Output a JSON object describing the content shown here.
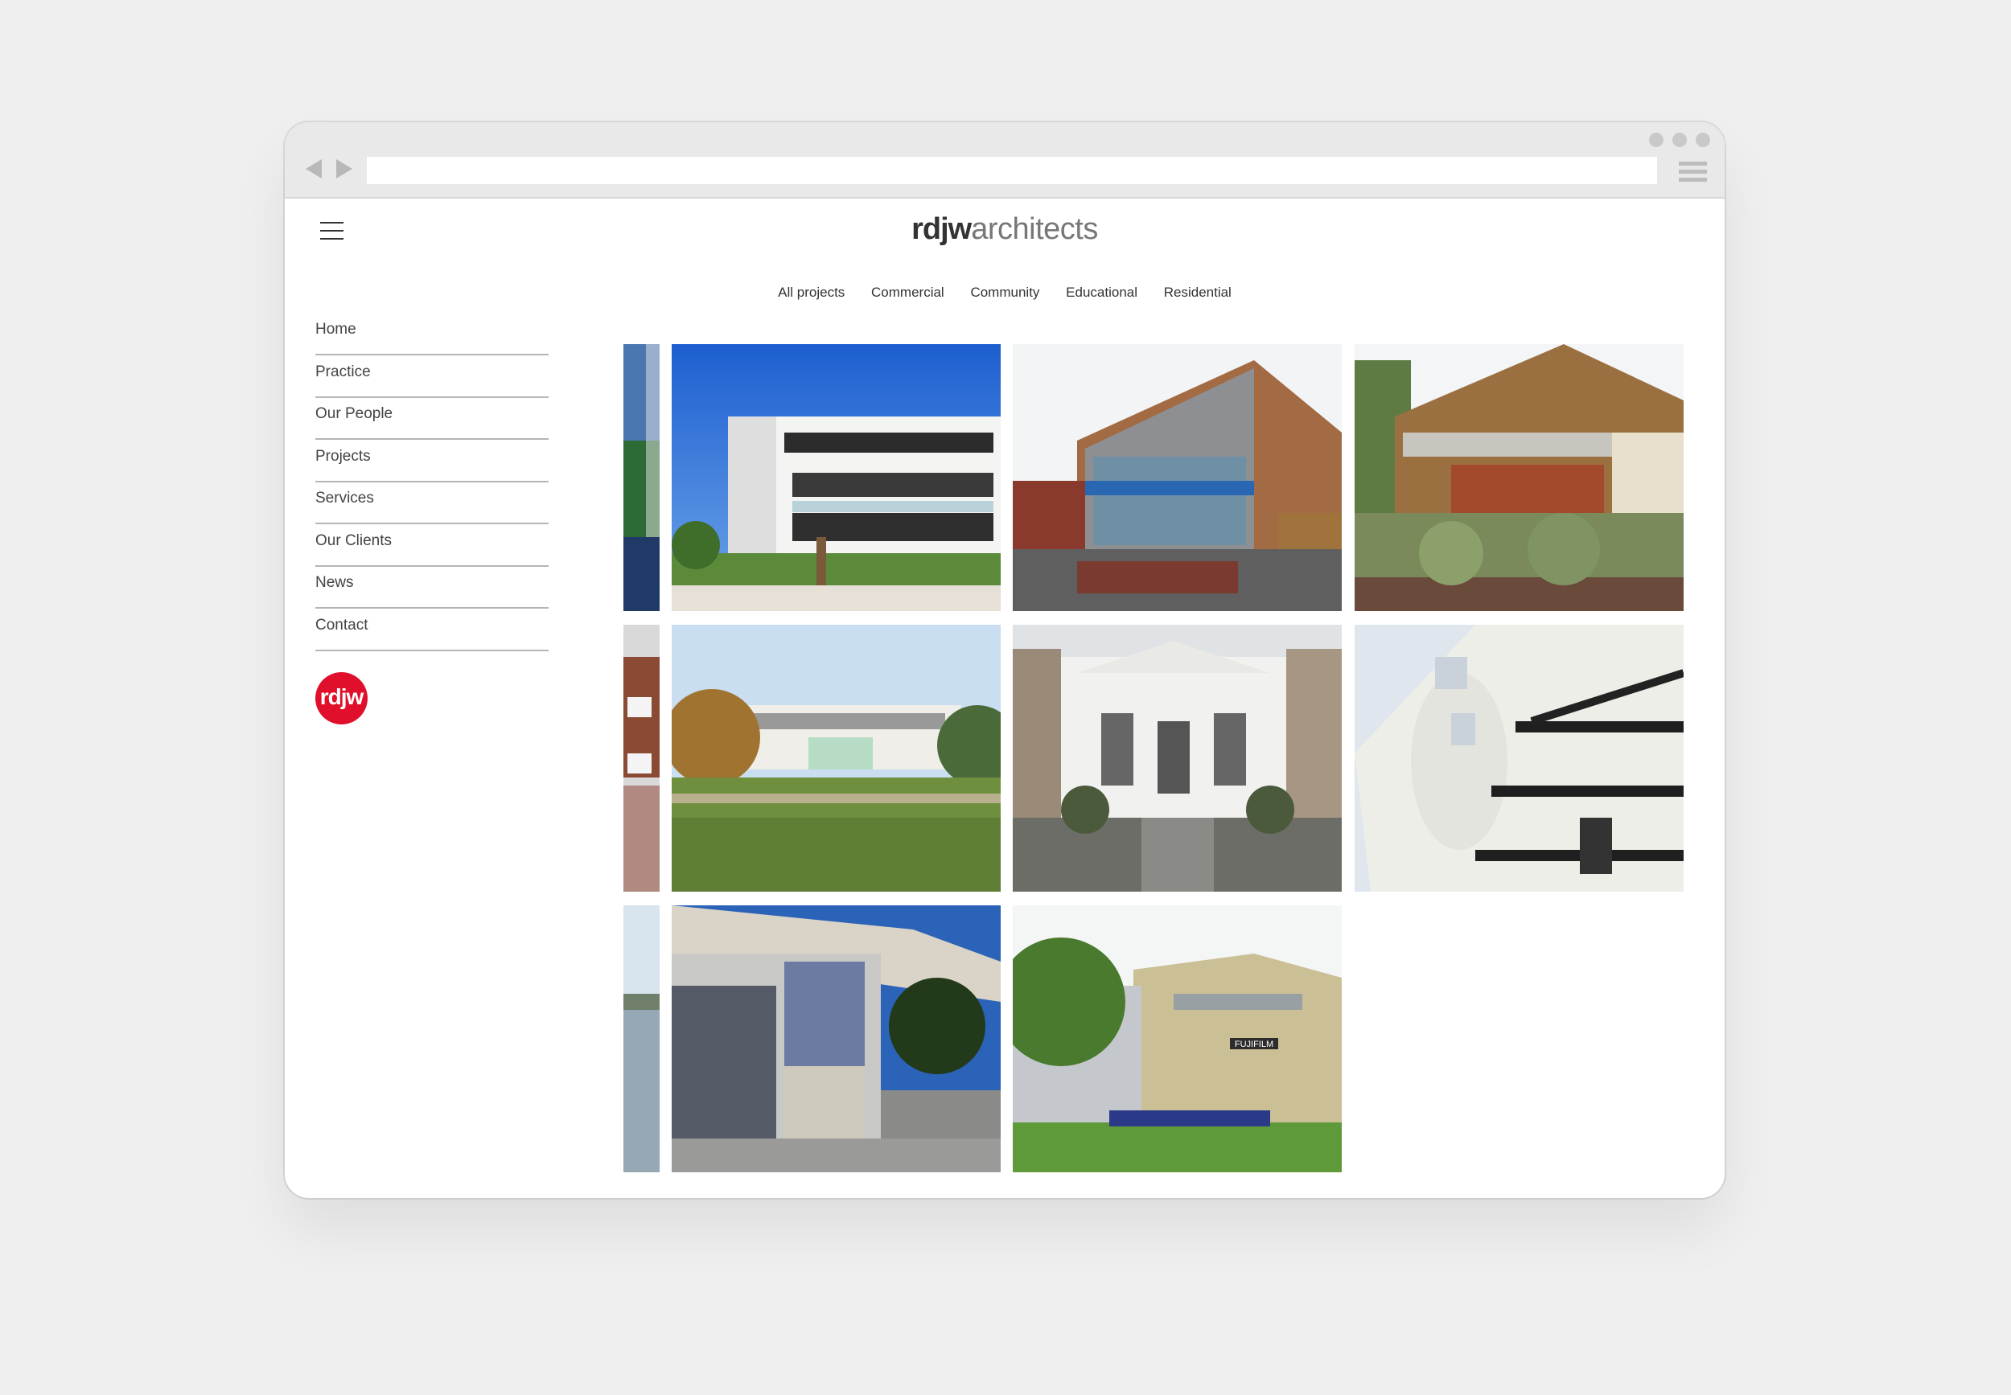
{
  "logo": {
    "bold": "rdjw",
    "light": "architects"
  },
  "filters": [
    "All projects",
    "Commercial",
    "Community",
    "Educational",
    "Residential"
  ],
  "nav": [
    "Home",
    "Practice",
    "Our People",
    "Projects",
    "Services",
    "Our Clients",
    "News",
    "Contact"
  ],
  "badge": "rdjw",
  "sign_fujifilm": "FUJIFILM"
}
